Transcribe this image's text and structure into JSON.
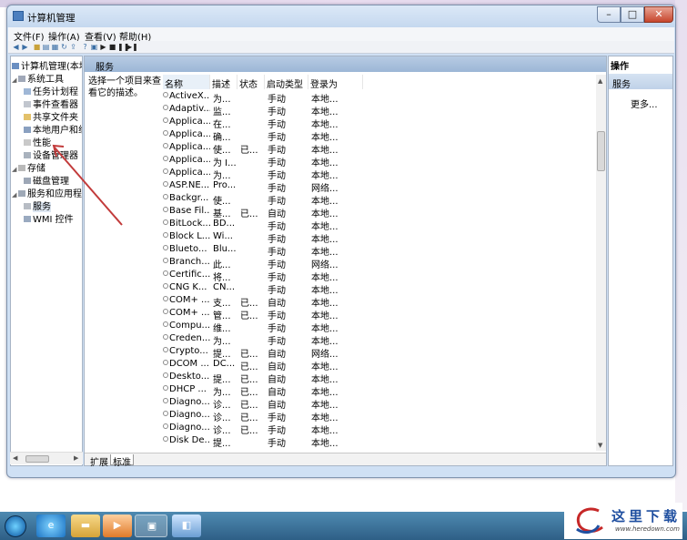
{
  "window": {
    "title": "计算机管理",
    "min": "–",
    "max": "□",
    "close": "✕"
  },
  "menu": {
    "file": "文件(F)",
    "action": "操作(A)",
    "view": "查看(V)",
    "help": "帮助(H)"
  },
  "tree": {
    "root": "计算机管理(本地",
    "system_tools": "系统工具",
    "task_scheduler": "任务计划程",
    "event_viewer": "事件查看器",
    "shared_folders": "共享文件夹",
    "local_users": "本地用户和组",
    "performance": "性能",
    "device_manager": "设备管理器",
    "storage": "存储",
    "disk_management": "磁盘管理",
    "services_apps": "服务和应用程",
    "services": "服务",
    "wmi": "WMI 控件"
  },
  "center": {
    "header": "服务",
    "description": [
      "选择一个项目来查",
      "看它的描述。"
    ],
    "columns": {
      "name": "名称",
      "desc": "描述",
      "status": "状态",
      "startup": "启动类型",
      "logon": "登录为"
    },
    "rows": [
      {
        "name": "ActiveX...",
        "desc": "为...",
        "status": "",
        "startup": "手动",
        "logon": "本地..."
      },
      {
        "name": "Adaptiv...",
        "desc": "监...",
        "status": "",
        "startup": "手动",
        "logon": "本地..."
      },
      {
        "name": "Applica...",
        "desc": "在...",
        "status": "",
        "startup": "手动",
        "logon": "本地..."
      },
      {
        "name": "Applica...",
        "desc": "确...",
        "status": "",
        "startup": "手动",
        "logon": "本地..."
      },
      {
        "name": "Applica...",
        "desc": "使...",
        "status": "已...",
        "startup": "手动",
        "logon": "本地..."
      },
      {
        "name": "Applica...",
        "desc": "为 I...",
        "status": "",
        "startup": "手动",
        "logon": "本地..."
      },
      {
        "name": "Applica...",
        "desc": "为...",
        "status": "",
        "startup": "手动",
        "logon": "本地..."
      },
      {
        "name": "ASP.NE...",
        "desc": "Pro...",
        "status": "",
        "startup": "手动",
        "logon": "网络..."
      },
      {
        "name": "Backgr...",
        "desc": "使...",
        "status": "",
        "startup": "手动",
        "logon": "本地..."
      },
      {
        "name": "Base Fil...",
        "desc": "基...",
        "status": "已...",
        "startup": "自动",
        "logon": "本地..."
      },
      {
        "name": "BitLock...",
        "desc": "BD...",
        "status": "",
        "startup": "手动",
        "logon": "本地..."
      },
      {
        "name": "Block L...",
        "desc": "Wi...",
        "status": "",
        "startup": "手动",
        "logon": "本地..."
      },
      {
        "name": "Blueto...",
        "desc": "Blu...",
        "status": "",
        "startup": "手动",
        "logon": "本地..."
      },
      {
        "name": "Branch...",
        "desc": "此...",
        "status": "",
        "startup": "手动",
        "logon": "网络..."
      },
      {
        "name": "Certific...",
        "desc": "将...",
        "status": "",
        "startup": "手动",
        "logon": "本地..."
      },
      {
        "name": "CNG K...",
        "desc": "CN...",
        "status": "",
        "startup": "手动",
        "logon": "本地..."
      },
      {
        "name": "COM+ ...",
        "desc": "支...",
        "status": "已...",
        "startup": "自动",
        "logon": "本地..."
      },
      {
        "name": "COM+ ...",
        "desc": "管...",
        "status": "已...",
        "startup": "手动",
        "logon": "本地..."
      },
      {
        "name": "Compu...",
        "desc": "维...",
        "status": "",
        "startup": "手动",
        "logon": "本地..."
      },
      {
        "name": "Creden...",
        "desc": "为...",
        "status": "",
        "startup": "手动",
        "logon": "本地..."
      },
      {
        "name": "Crypto...",
        "desc": "提...",
        "status": "已...",
        "startup": "自动",
        "logon": "网络..."
      },
      {
        "name": "DCOM ...",
        "desc": "DC...",
        "status": "已...",
        "startup": "自动",
        "logon": "本地..."
      },
      {
        "name": "Deskto...",
        "desc": "提...",
        "status": "已...",
        "startup": "自动",
        "logon": "本地..."
      },
      {
        "name": "DHCP ...",
        "desc": "为...",
        "status": "已...",
        "startup": "自动",
        "logon": "本地..."
      },
      {
        "name": "Diagno...",
        "desc": "诊...",
        "status": "已...",
        "startup": "自动",
        "logon": "本地..."
      },
      {
        "name": "Diagno...",
        "desc": "诊...",
        "status": "已...",
        "startup": "手动",
        "logon": "本地..."
      },
      {
        "name": "Diagno...",
        "desc": "诊...",
        "status": "已...",
        "startup": "手动",
        "logon": "本地..."
      },
      {
        "name": "Disk De...",
        "desc": "提...",
        "status": "",
        "startup": "手动",
        "logon": "本地..."
      }
    ],
    "tabs": {
      "extended": "扩展",
      "standard": "标准"
    }
  },
  "actions": {
    "header": "操作",
    "section": "服务",
    "more": "更多..."
  },
  "watermark": {
    "brand": "这里下载",
    "url": "www.heredown.com"
  },
  "colors": {
    "arrow": "#c23b3b",
    "header": "#9cb6d6",
    "taskbar": "#3d739b"
  }
}
